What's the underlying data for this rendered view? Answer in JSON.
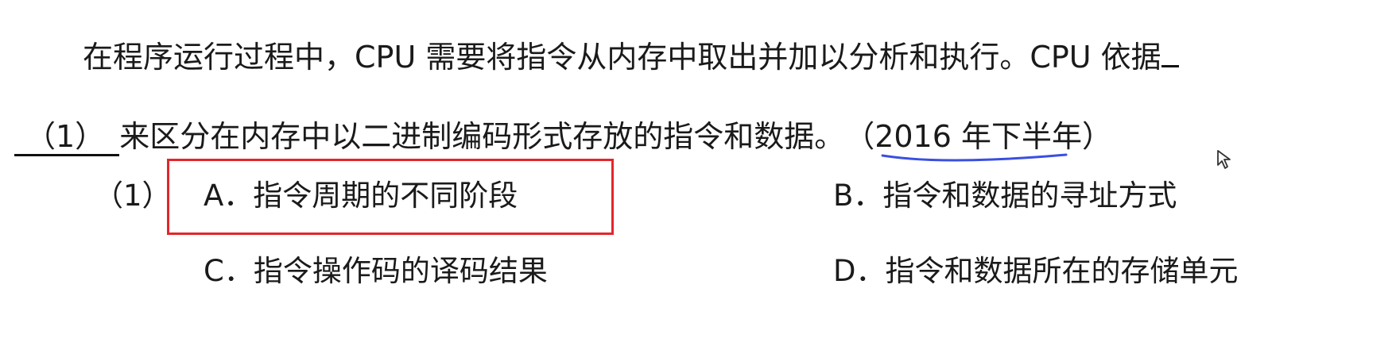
{
  "question": {
    "line1": "在程序运行过程中，CPU 需要将指令从内存中取出并加以分析和执行。CPU 依据",
    "blank_label": "（1）",
    "line2_text": "来区分在内存中以二进制编码形式存放的指令和数据。",
    "year_note": "（2016 年下半年）"
  },
  "options": {
    "group_label": "（1）",
    "a": "A．指令周期的不同阶段",
    "b": "B．指令和数据的寻址方式",
    "c": "C．指令操作码的译码结果",
    "d": "D．指令和数据所在的存储单元"
  },
  "highlight": {
    "box_color": "#e3262b",
    "underline_color": "#3a4fe0",
    "highlighted_option": "A"
  }
}
